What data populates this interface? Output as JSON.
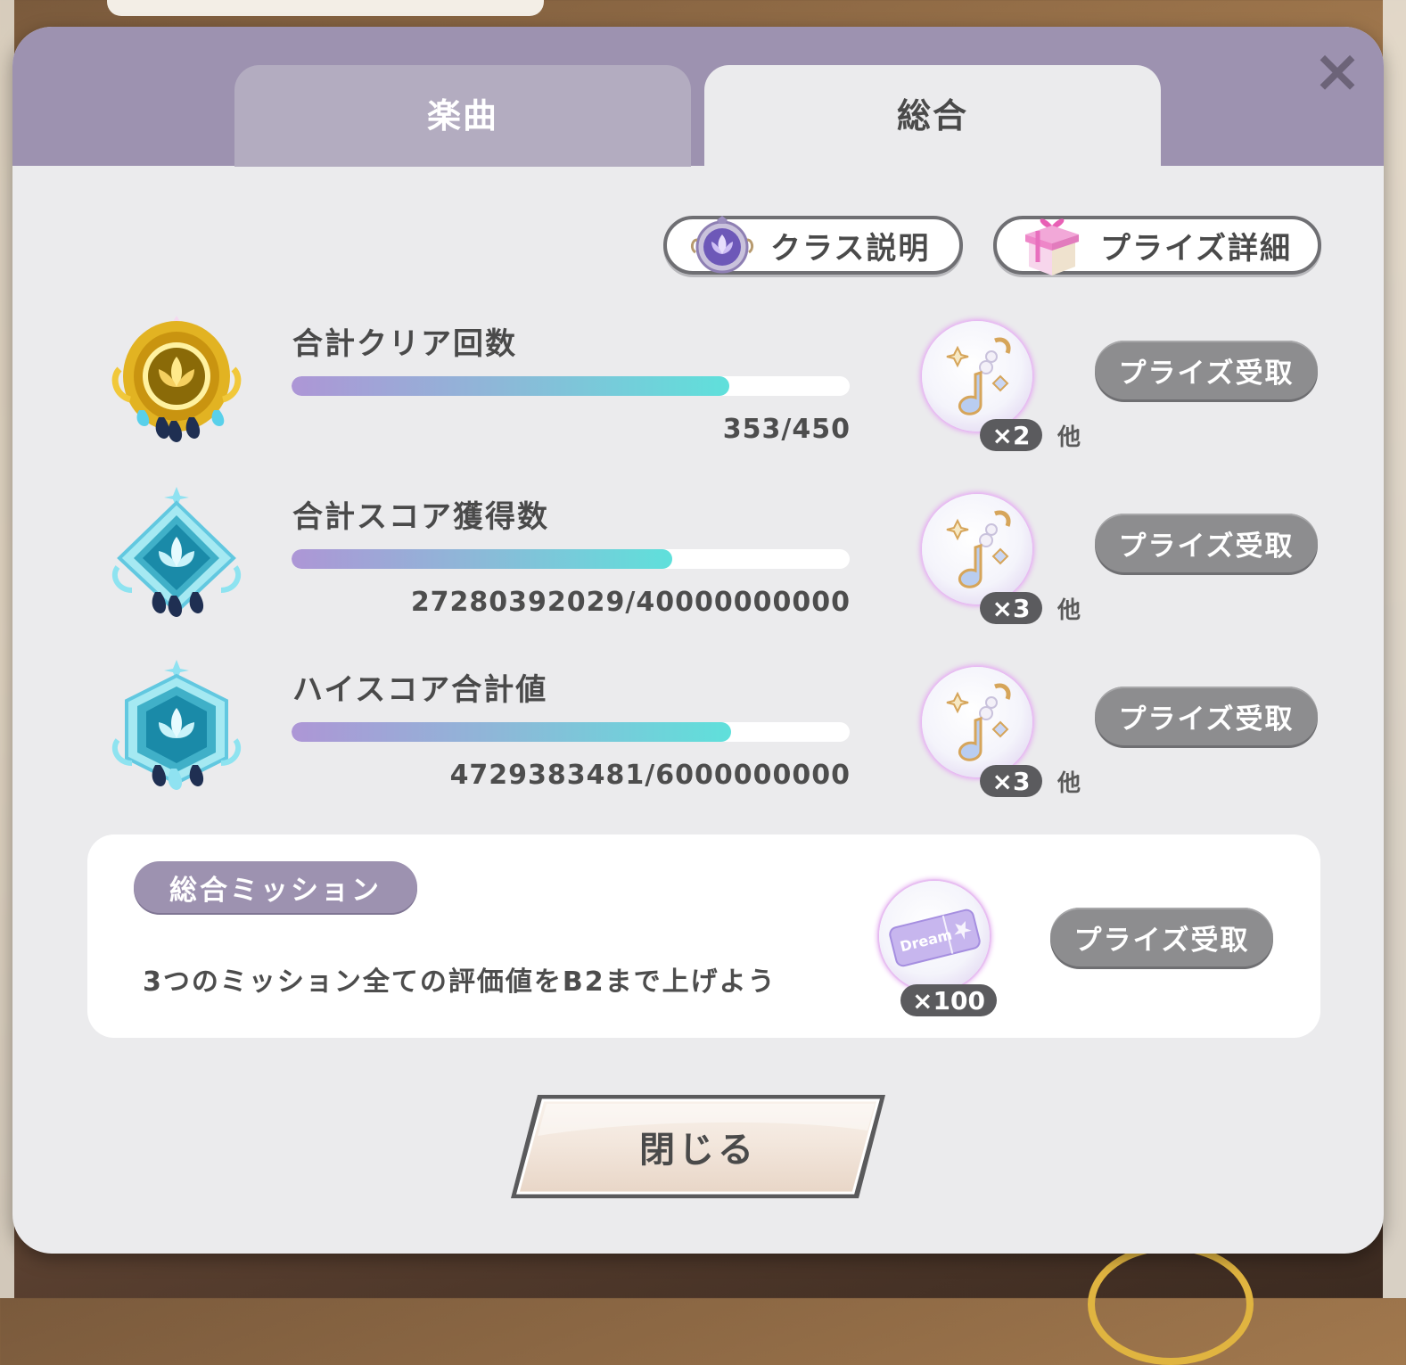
{
  "tabs": [
    {
      "label": "楽曲",
      "active": false
    },
    {
      "label": "総合",
      "active": true
    }
  ],
  "close_icon": "×",
  "header_buttons": {
    "class_info": {
      "label": "クラス説明",
      "icon": "lotus-emblem-icon"
    },
    "prize_details": {
      "label": "プライズ詳細",
      "icon": "gift-box-icon"
    }
  },
  "rows": [
    {
      "title": "合計クリア回数",
      "value": "353/450",
      "progress": 0.784,
      "badge": "gold-lotus-badge-icon",
      "reward_icon": "music-note-charm-icon",
      "reward_count": "×2",
      "other_label": "他",
      "button_label": "プライズ受取"
    },
    {
      "title": "合計スコア獲得数",
      "value": "27280392029/40000000000",
      "progress": 0.682,
      "badge": "diamond-lotus-badge-icon",
      "reward_icon": "music-note-charm-icon",
      "reward_count": "×3",
      "other_label": "他",
      "button_label": "プライズ受取"
    },
    {
      "title": "ハイスコア合計値",
      "value": "4729383481/6000000000",
      "progress": 0.788,
      "badge": "hexagon-lotus-badge-icon",
      "reward_icon": "music-note-charm-icon",
      "reward_count": "×3",
      "other_label": "他",
      "button_label": "プライズ受取"
    }
  ],
  "mission": {
    "tag": "総合ミッション",
    "text": "3つのミッション全ての評価値をB2まで上げよう",
    "reward_icon": "dream-ticket-icon",
    "reward_ticket_text": "Dream",
    "reward_count": "×100",
    "button_label": "プライズ受取"
  },
  "close_button": {
    "label": "閉じる"
  },
  "colors": {
    "header": "#9d92b0",
    "panel": "#ebebed",
    "button_gray": "#8d8d8f",
    "bar_start": "#ad96d6",
    "bar_end": "#5fe0db"
  }
}
